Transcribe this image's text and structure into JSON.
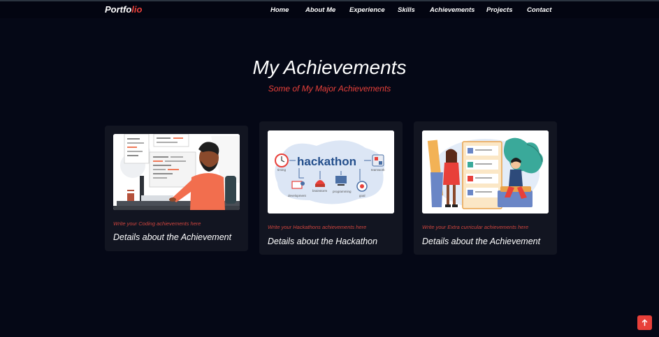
{
  "brand": {
    "prefix": "Portfo",
    "accent": "lio"
  },
  "nav": {
    "links": [
      {
        "label": "Home"
      },
      {
        "label": "About Me"
      },
      {
        "label": "Experience"
      },
      {
        "label": "Skills"
      },
      {
        "label": "Achievements"
      },
      {
        "label": "Projects"
      },
      {
        "label": "Contact"
      }
    ]
  },
  "section": {
    "title": "My Achievements",
    "subtitle": "Some of My Major Achievements"
  },
  "cards": [
    {
      "caption": "Write your Coding achievements here",
      "title": "Details about the Achievement",
      "image": "coding-illustration"
    },
    {
      "caption": "Write your Hackathons achievements here",
      "title": "Details about the Hackathon",
      "image": "hackathon-illustration"
    },
    {
      "caption": "Write your Extra curricular achievements here",
      "title": "Details about the Achievement",
      "image": "extracurricular-illustration"
    }
  ],
  "hackathon_image": {
    "word": "hackathon",
    "labels": [
      "timing",
      "teamwork",
      "development",
      "brainstorm",
      "programming",
      "goal"
    ]
  },
  "scroll_top": {
    "icon": "arrow-up-icon"
  },
  "colors": {
    "background": "#050816",
    "accent": "#e8403a",
    "card": "#121521"
  }
}
